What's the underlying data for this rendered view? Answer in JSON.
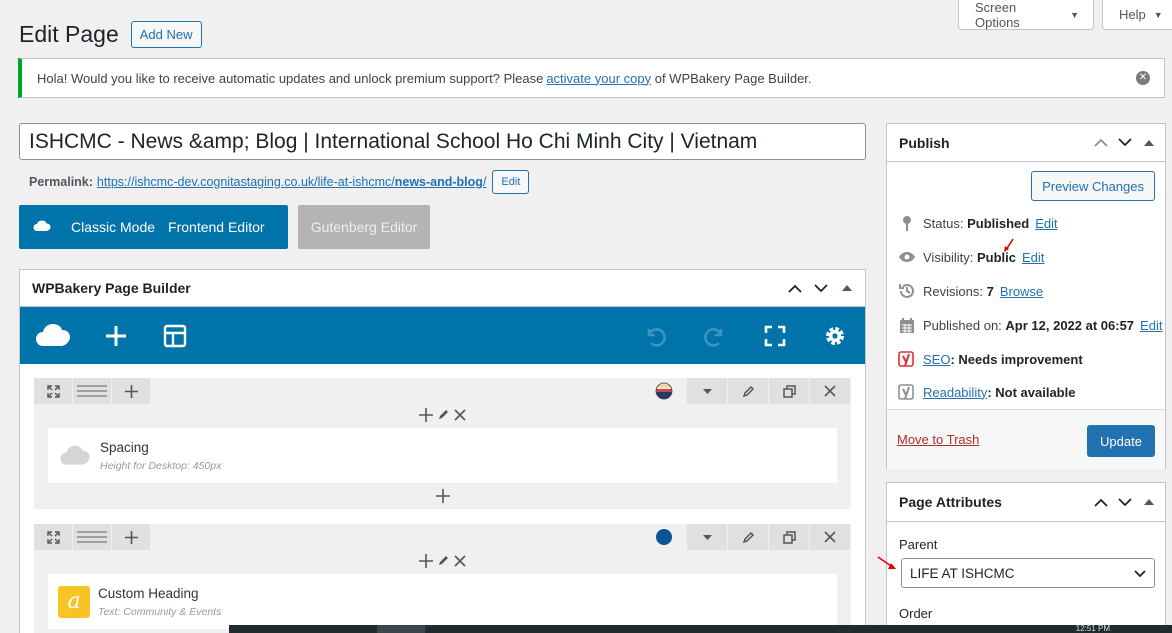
{
  "screen_meta": {
    "screen_options": "Screen Options",
    "help": "Help"
  },
  "header": {
    "title": "Edit Page",
    "add_new": "Add New"
  },
  "notice": {
    "text_before": "Hola! Would you like to receive automatic updates and unlock premium support? Please ",
    "link": "activate your copy",
    "text_after": " of WPBakery Page Builder."
  },
  "post_title": "ISHCMC - News &amp; Blog | International School Ho Chi Minh City | Vietnam",
  "permalink": {
    "label": "Permalink:",
    "url_base": "https://ishcmc-dev.cognitastaging.co.uk/life-at-ishcmc/",
    "url_slug": "news-and-blog",
    "url_end": "/",
    "edit": "Edit"
  },
  "modes": {
    "classic": "Classic Mode",
    "frontend": "Frontend Editor",
    "gutenberg": "Gutenberg Editor"
  },
  "wpbakery": {
    "title": "WPBakery Page Builder",
    "rows": [
      {
        "element": {
          "name": "Spacing",
          "sub": "Height for Desktop: 450px"
        }
      },
      {
        "element": {
          "name": "Custom Heading",
          "sub": "Text: Community & Events"
        }
      }
    ]
  },
  "publish": {
    "title": "Publish",
    "preview": "Preview Changes",
    "status_label": "Status: ",
    "status_value": "Published",
    "status_edit": "Edit",
    "visibility_label": "Visibility: ",
    "visibility_value": "Public",
    "visibility_edit": "Edit",
    "revisions_label": "Revisions: ",
    "revisions_value": "7",
    "revisions_link": "Browse",
    "published_label": "Published on: ",
    "published_value": "Apr 12, 2022 at 06:57",
    "published_edit": "Edit",
    "seo_link": "SEO",
    "seo_value": ": Needs improvement",
    "readability_link": "Readability",
    "readability_value": ": Not available",
    "trash": "Move to Trash",
    "update": "Update"
  },
  "attributes": {
    "title": "Page Attributes",
    "parent_label": "Parent",
    "parent_value": "LIFE AT ISHCMC",
    "order_label": "Order"
  },
  "taskbar": {
    "clock": "12:51 PM"
  },
  "colors": {
    "wp_blue": "#2271b1",
    "wpb_blue": "#0073aa",
    "notice_green": "#00a32a",
    "yoast_red": "#dc3232",
    "arrow_red": "#e00000"
  }
}
